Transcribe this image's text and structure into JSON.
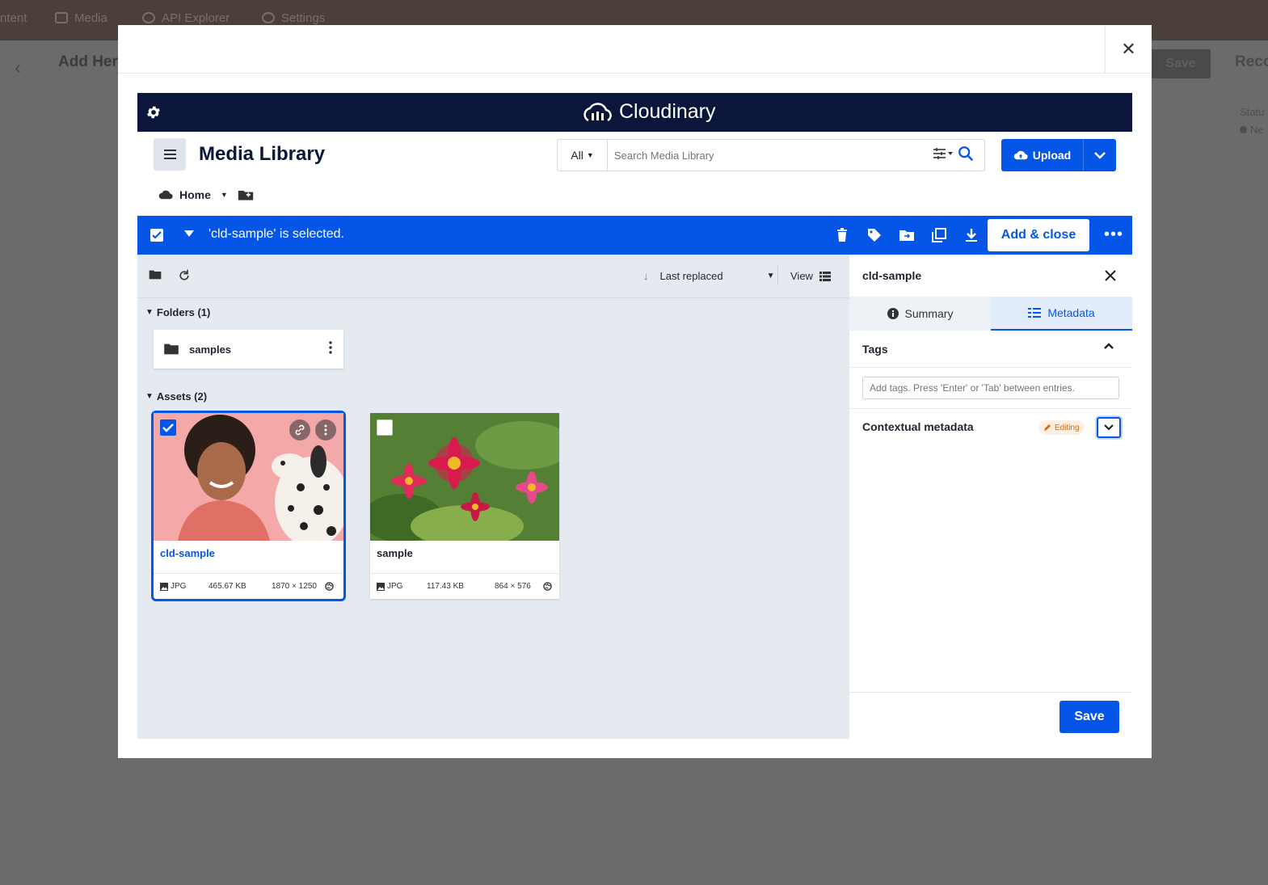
{
  "background": {
    "nav": [
      "ntent",
      "Media",
      "API Explorer",
      "Settings"
    ],
    "page_title": "Add Her",
    "save_label": "Save",
    "right_title": "Reco",
    "status_label": "Statu",
    "status_value": "Ne"
  },
  "modal": {
    "close_glyph": "✕"
  },
  "cloudinary": {
    "brand": "Cloudinary",
    "title": "Media Library",
    "search": {
      "scope": "All",
      "placeholder": "Search Media Library"
    },
    "upload_label": "Upload",
    "breadcrumb": "Home"
  },
  "selection": {
    "message": "'cld-sample' is selected.",
    "add_close_label": "Add & close"
  },
  "content": {
    "sort_label": "Last replaced",
    "view_label": "View",
    "folders_label": "Folders (1)",
    "folders": [
      {
        "name": "samples"
      }
    ],
    "assets_label": "Assets (2)",
    "assets": [
      {
        "name": "cld-sample",
        "format": "JPG",
        "size": "465.67 KB",
        "dimensions": "1870 × 1250",
        "selected": true
      },
      {
        "name": "sample",
        "format": "JPG",
        "size": "117.43 KB",
        "dimensions": "864 × 576",
        "selected": false
      }
    ]
  },
  "panel": {
    "title": "cld-sample",
    "tabs": [
      {
        "label": "Summary",
        "active": false
      },
      {
        "label": "Metadata",
        "active": true
      }
    ],
    "tags_label": "Tags",
    "tags_placeholder": "Add tags. Press 'Enter' or 'Tab' between entries.",
    "contextual_label": "Contextual metadata",
    "editing_badge": "Editing",
    "save_label": "Save"
  },
  "colors": {
    "accent": "#0556e6",
    "header": "#0c163b",
    "editing": "#d26a12"
  }
}
